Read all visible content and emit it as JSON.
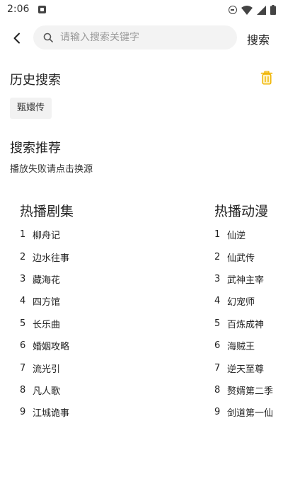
{
  "status_bar": {
    "time": "2:06",
    "icons": [
      "notification-icon",
      "do-not-disturb-icon",
      "wifi-icon",
      "signal-icon",
      "battery-icon"
    ]
  },
  "search": {
    "placeholder": "请输入搜索关键字",
    "value": "",
    "button_label": "搜索"
  },
  "history": {
    "title": "历史搜索",
    "items": [
      "甄嬛传"
    ]
  },
  "recommend": {
    "title": "搜索推荐",
    "subtitle": "播放失败请点击换源"
  },
  "rankings": [
    {
      "title": "热播剧集",
      "items": [
        {
          "rank": "1",
          "name": "柳舟记"
        },
        {
          "rank": "2",
          "name": "边水往事"
        },
        {
          "rank": "3",
          "name": "藏海花"
        },
        {
          "rank": "4",
          "name": "四方馆"
        },
        {
          "rank": "5",
          "name": "长乐曲"
        },
        {
          "rank": "6",
          "name": "婚姻攻略"
        },
        {
          "rank": "7",
          "name": "流光引"
        },
        {
          "rank": "8",
          "name": "凡人歌"
        },
        {
          "rank": "9",
          "name": "江城诡事"
        }
      ]
    },
    {
      "title": "热播动漫",
      "items": [
        {
          "rank": "1",
          "name": "仙逆"
        },
        {
          "rank": "2",
          "name": "仙武传"
        },
        {
          "rank": "3",
          "name": "武神主宰"
        },
        {
          "rank": "4",
          "name": "幻宠师"
        },
        {
          "rank": "5",
          "name": "百炼成神"
        },
        {
          "rank": "6",
          "name": "海贼王"
        },
        {
          "rank": "7",
          "name": "逆天至尊"
        },
        {
          "rank": "8",
          "name": "赘婿第二季"
        },
        {
          "rank": "9",
          "name": "剑道第一仙"
        }
      ]
    }
  ],
  "colors": {
    "accent": "#f0b400",
    "text": "#222222",
    "search_bg": "#f3f3f3",
    "chip_bg": "#f2f2f2"
  }
}
